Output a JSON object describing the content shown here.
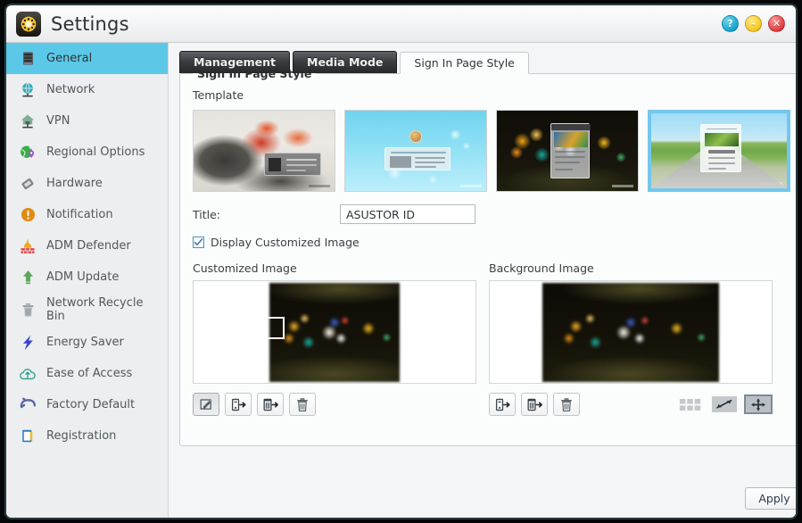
{
  "window": {
    "title": "Settings",
    "app_icon": "gear-icon",
    "buttons": [
      {
        "name": "help-button",
        "glyph": "?",
        "color": "#15a6cf"
      },
      {
        "name": "minimize-button",
        "glyph": "–",
        "color": "#f5c81c"
      },
      {
        "name": "close-button",
        "glyph": "✕",
        "color": "#e23b3b"
      }
    ]
  },
  "sidebar": {
    "items": [
      {
        "label": "General",
        "icon": "server-rack-icon",
        "active": true
      },
      {
        "label": "Network",
        "icon": "globe-network-icon",
        "active": false
      },
      {
        "label": "VPN",
        "icon": "home-network-icon",
        "active": false
      },
      {
        "label": "Regional Options",
        "icon": "globe-pin-icon",
        "active": false
      },
      {
        "label": "Hardware",
        "icon": "chip-icon",
        "active": false
      },
      {
        "label": "Notification",
        "icon": "alert-circle-icon",
        "active": false
      },
      {
        "label": "ADM Defender",
        "icon": "firewall-icon",
        "active": false
      },
      {
        "label": "ADM Update",
        "icon": "up-arrow-icon",
        "active": false
      },
      {
        "label": "Network Recycle Bin",
        "icon": "trash-icon",
        "active": false
      },
      {
        "label": "Energy Saver",
        "icon": "lightning-icon",
        "active": false
      },
      {
        "label": "Ease of Access",
        "icon": "cloud-access-icon",
        "active": false
      },
      {
        "label": "Factory Default",
        "icon": "undo-arrow-icon",
        "active": false
      },
      {
        "label": "Registration",
        "icon": "note-pencil-icon",
        "active": false
      }
    ]
  },
  "tabs": [
    {
      "label": "Management",
      "active": false
    },
    {
      "label": "Media Mode",
      "active": false
    },
    {
      "label": "Sign In Page Style",
      "active": true
    }
  ],
  "group": {
    "legend": "Sign In Page Style",
    "template_label": "Template",
    "templates": [
      {
        "name": "template-desk",
        "selected": false
      },
      {
        "name": "template-sky",
        "selected": false
      },
      {
        "name": "template-bokeh",
        "selected": false
      },
      {
        "name": "template-road",
        "selected": true
      }
    ],
    "title_field": {
      "label": "Title:",
      "value": "ASUSTOR ID",
      "placeholder": ""
    },
    "display_customized_image": {
      "label": "Display Customized Image",
      "checked": true
    },
    "customized_image": {
      "title": "Customized Image",
      "tools": [
        {
          "name": "crop-edit-button",
          "icon": "pencil-square-icon",
          "pressed": true
        },
        {
          "name": "upload-file-button",
          "icon": "file-arrow-icon",
          "pressed": false
        },
        {
          "name": "upload-from-nas-button",
          "icon": "folder-arrow-icon",
          "pressed": false
        },
        {
          "name": "delete-image-button",
          "icon": "trash-icon",
          "pressed": false
        }
      ]
    },
    "background_image": {
      "title": "Background Image",
      "tools": [
        {
          "name": "upload-file-button",
          "icon": "file-arrow-icon",
          "pressed": false
        },
        {
          "name": "upload-from-nas-button",
          "icon": "folder-arrow-icon",
          "pressed": false
        },
        {
          "name": "delete-image-button",
          "icon": "trash-icon",
          "pressed": false
        }
      ],
      "display_modes": [
        {
          "name": "tile-mode-button",
          "icon": "tile-grid-icon",
          "active": false
        },
        {
          "name": "stretch-mode-button",
          "icon": "diagonal-arrow-icon",
          "active": false
        },
        {
          "name": "fit-mode-button",
          "icon": "four-way-arrow-icon",
          "active": true
        }
      ]
    }
  },
  "footer": {
    "apply_label": "Apply"
  },
  "colors": {
    "sidebar_active": "#5bc8e8",
    "template_selected_border": "#73c7ec",
    "tab_active_bg": "#fbfcfc",
    "window_bg": "#f4f5f6"
  }
}
